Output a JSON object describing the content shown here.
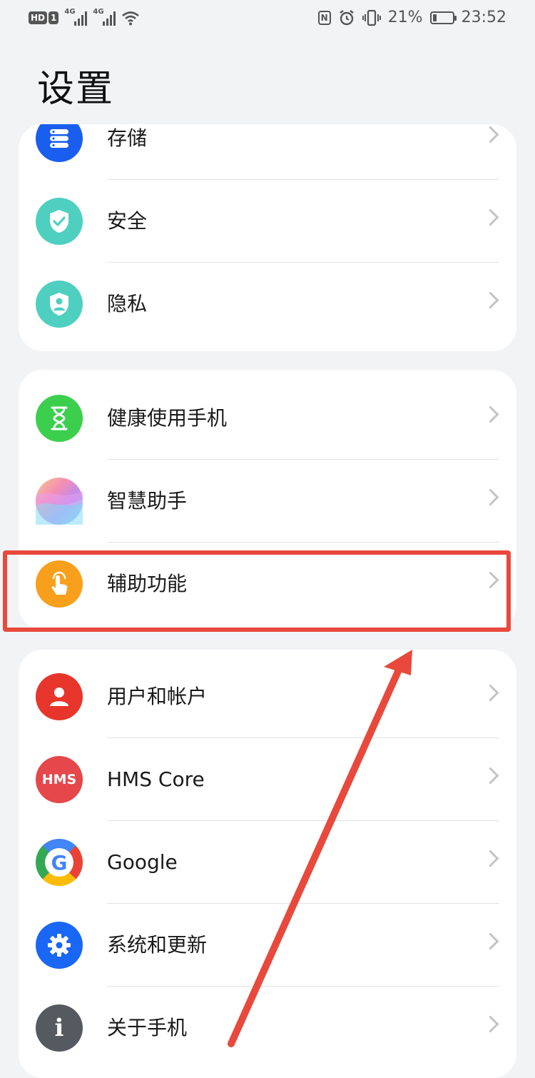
{
  "status_bar": {
    "hd": "HD",
    "sim": "1",
    "net1": "4G",
    "net2": "4G",
    "nfc": "N",
    "battery_pct": "21%",
    "battery_level": 0.21,
    "time": "23:52"
  },
  "page_title": "设置",
  "groups": [
    {
      "items": [
        {
          "label": "存储",
          "icon": "storage-icon",
          "color": "#1a5ef0"
        },
        {
          "label": "安全",
          "icon": "security-shield-icon",
          "color": "#4fcfbf"
        },
        {
          "label": "隐私",
          "icon": "privacy-icon",
          "color": "#4fcfbf"
        }
      ]
    },
    {
      "items": [
        {
          "label": "健康使用手机",
          "icon": "hourglass-icon",
          "color": "#3ccf4e"
        },
        {
          "label": "智慧助手",
          "icon": "assistant-icon",
          "color": "#c9a6f5"
        },
        {
          "label": "辅助功能",
          "icon": "accessibility-hand-icon",
          "color": "#f8a01c"
        }
      ]
    },
    {
      "items": [
        {
          "label": "用户和帐户",
          "icon": "user-icon",
          "color": "#e8352c"
        },
        {
          "label": "HMS Core",
          "icon": "hms-core-icon",
          "icon_text": "HMS",
          "color": "#e5474a"
        },
        {
          "label": "Google",
          "icon": "google-icon",
          "icon_text": "G",
          "color": "#ffffff"
        },
        {
          "label": "系统和更新",
          "icon": "gear-icon",
          "color": "#1a66f5"
        },
        {
          "label": "关于手机",
          "icon": "info-icon",
          "icon_text": "i",
          "color": "#555a60"
        }
      ]
    }
  ],
  "annotation": {
    "highlight_color": "#e8493c",
    "arrow_color": "#e8493c"
  }
}
